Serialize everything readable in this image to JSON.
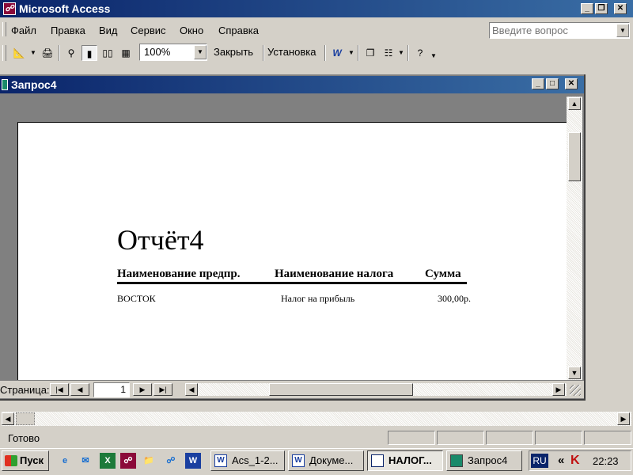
{
  "app": {
    "title": "Microsoft Access"
  },
  "menu": {
    "items": [
      "Файл",
      "Правка",
      "Вид",
      "Сервис",
      "Окно",
      "Справка"
    ],
    "help_placeholder": "Введите вопрос"
  },
  "toolbar": {
    "zoom_value": "100%",
    "close_label": "Закрыть",
    "setup_label": "Установка"
  },
  "child_window": {
    "title": "Запрос4"
  },
  "report": {
    "title": "Отчёт4",
    "headers": [
      "Наименование предпр.",
      "Наименование налога",
      "Сумма"
    ],
    "rows": [
      {
        "company": "ВОСТОК",
        "tax": "Налог на прибыль",
        "amount": "300,00р."
      }
    ]
  },
  "navigation": {
    "label": "Страница:",
    "page_value": "1"
  },
  "status": {
    "text": "Готово"
  },
  "taskbar": {
    "start_label": "Пуск",
    "buttons": [
      "Acs_1-2...",
      "Докуме...",
      "НАЛОГ...",
      "Запрос4"
    ],
    "language": "RU",
    "tray_arrow": "«",
    "clock": "22:23"
  },
  "colors": {
    "title_bar": "#0a246a",
    "title_bar_end": "#3a6ea5",
    "window_face": "#d4d0c8",
    "taskbar_language_bg": "#0a246a"
  }
}
